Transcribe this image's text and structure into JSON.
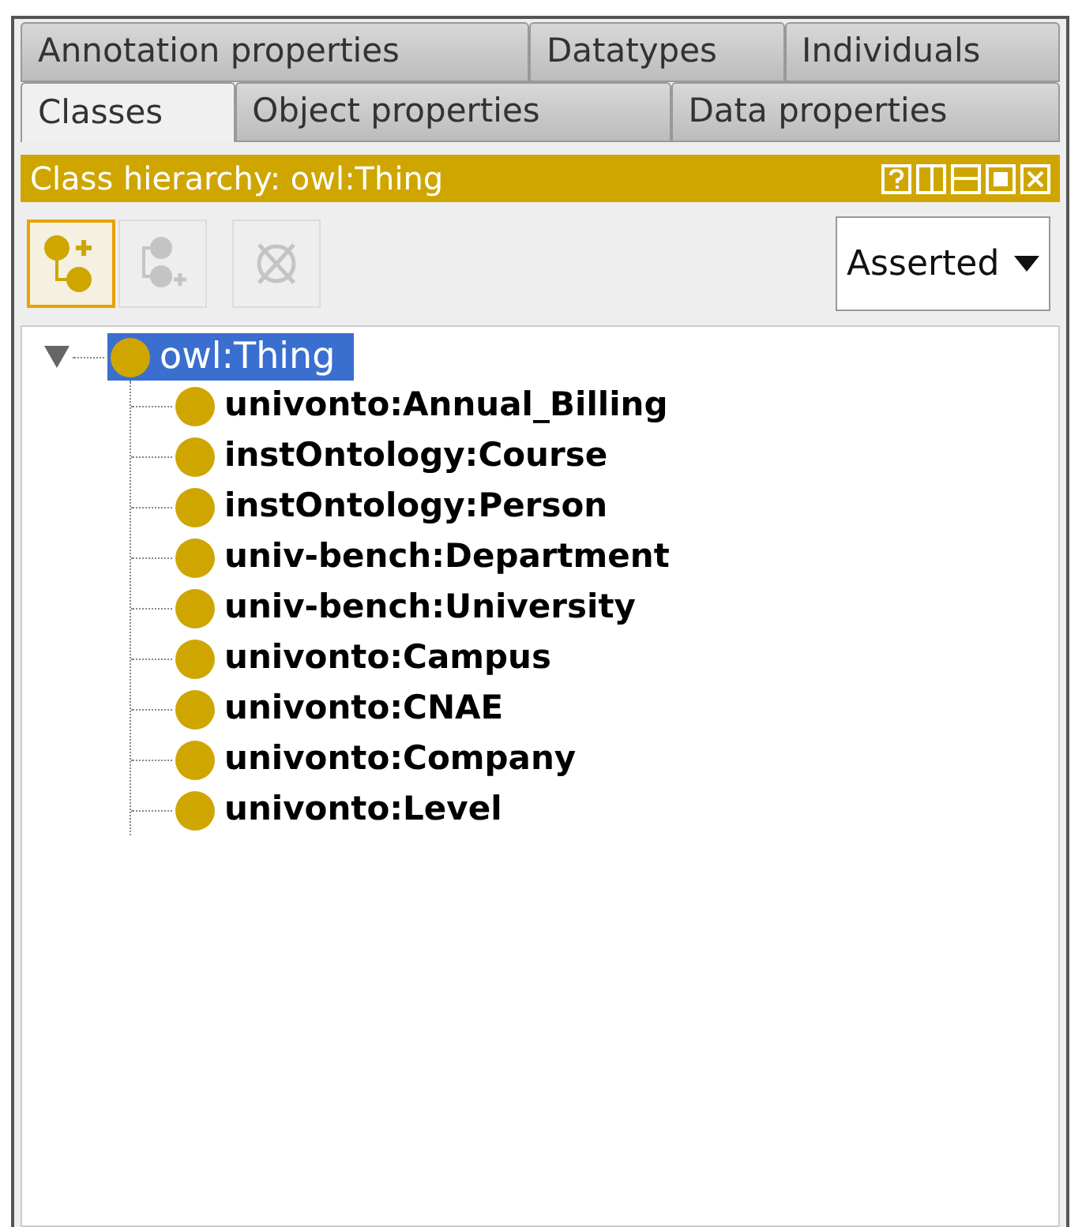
{
  "tab_rows": [
    {
      "tabs": [
        {
          "label": "Annotation properties",
          "selected": false
        },
        {
          "label": "Datatypes",
          "selected": false
        },
        {
          "label": "Individuals",
          "selected": false
        }
      ]
    },
    {
      "tabs": [
        {
          "label": "Classes",
          "selected": true
        },
        {
          "label": "Object properties",
          "selected": false
        },
        {
          "label": "Data properties",
          "selected": false
        }
      ]
    }
  ],
  "view": {
    "title": "Class hierarchy: owl:Thing",
    "window_buttons": [
      {
        "kind": "help"
      },
      {
        "kind": "split-vertical"
      },
      {
        "kind": "split-horizontal"
      },
      {
        "kind": "maximize"
      },
      {
        "kind": "close"
      }
    ]
  },
  "toolbar": {
    "buttons": [
      {
        "kind": "add-subclass",
        "selected": true,
        "disabled": false
      },
      {
        "kind": "add-sibling",
        "selected": false,
        "disabled": true
      },
      {
        "kind": "delete",
        "selected": false,
        "disabled": true
      }
    ],
    "dropdown": {
      "value": "Asserted"
    }
  },
  "tree": {
    "label": "owl:Thing",
    "expanded": true,
    "selected": true,
    "children": [
      {
        "label": "univonto:Annual_Billing",
        "selected": false
      },
      {
        "label": "instOntology:Course",
        "selected": false
      },
      {
        "label": "instOntology:Person",
        "selected": false
      },
      {
        "label": "univ-bench:Department",
        "selected": false
      },
      {
        "label": "univ-bench:University",
        "selected": false
      },
      {
        "label": "univonto:Campus",
        "selected": false
      },
      {
        "label": "univonto:CNAE",
        "selected": false
      },
      {
        "label": "univonto:Company",
        "selected": false
      },
      {
        "label": "univonto:Level",
        "selected": false
      }
    ]
  }
}
